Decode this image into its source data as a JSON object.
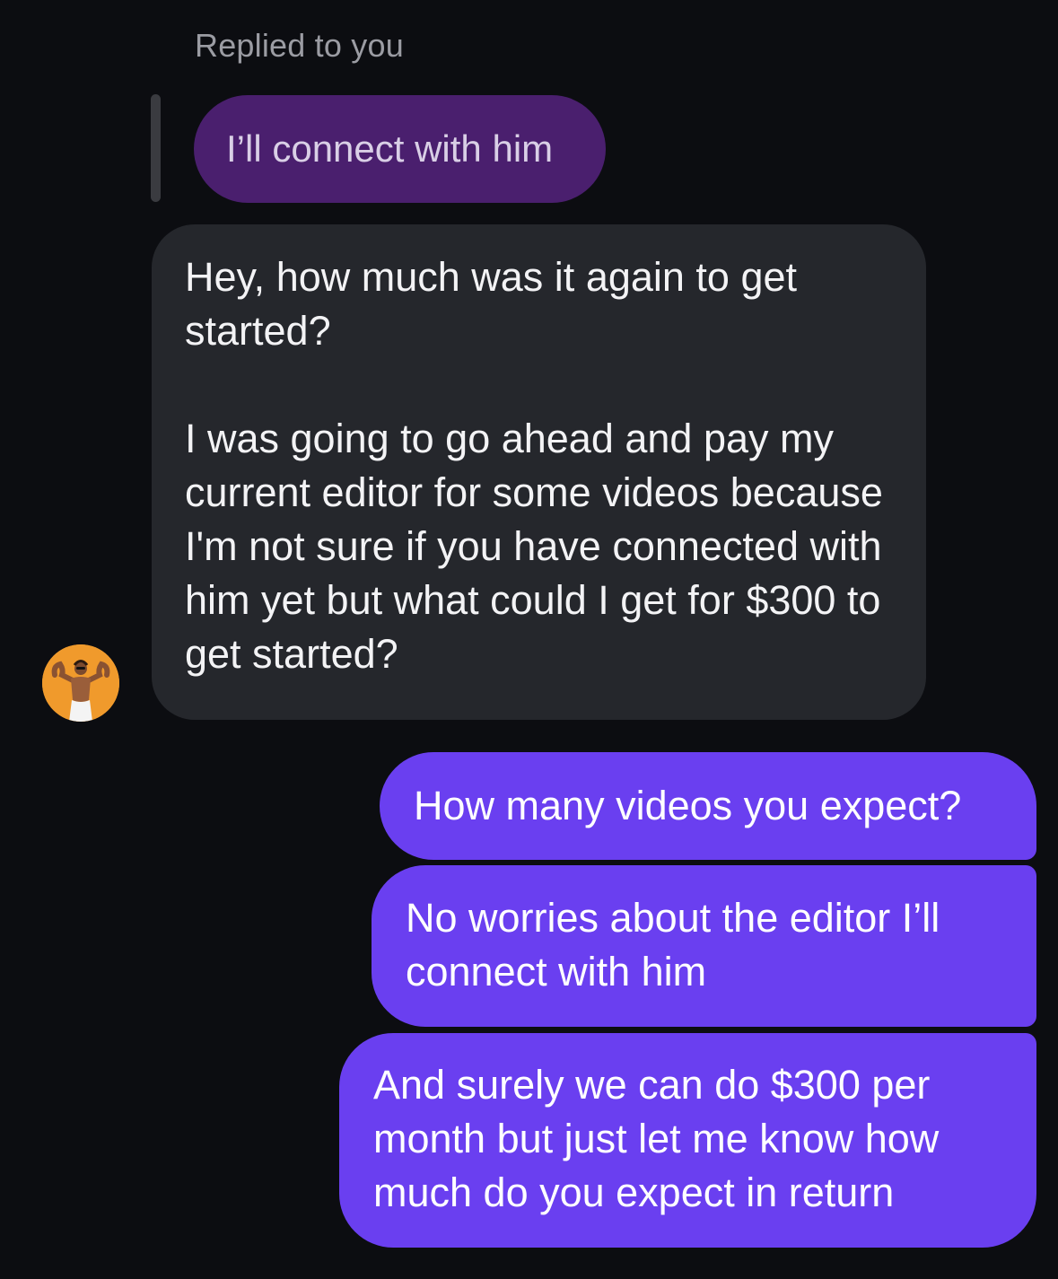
{
  "conversation": {
    "reply_context": {
      "label": "Replied to you",
      "quoted_text": "I’ll connect with him"
    },
    "incoming": {
      "paragraph_1": "Hey, how much was it again to get started?",
      "paragraph_2": "I was going to go ahead and pay my current editor for some videos because I'm not sure if you have connected with him yet but what could I get for $300 to get started?"
    },
    "outgoing": [
      {
        "text": "How many videos you expect?"
      },
      {
        "text": "No worries about the editor I’ll connect with him"
      },
      {
        "text": "And surely we can do $300 per month but just let me know how much do you expect in return"
      }
    ]
  },
  "colors": {
    "background": "#0c0d11",
    "incoming_bubble": "#25272c",
    "outgoing_bubble": "#6a3ff0",
    "quoted_bubble": "#4a1f6e",
    "avatar_bg": "#f09a2c"
  }
}
